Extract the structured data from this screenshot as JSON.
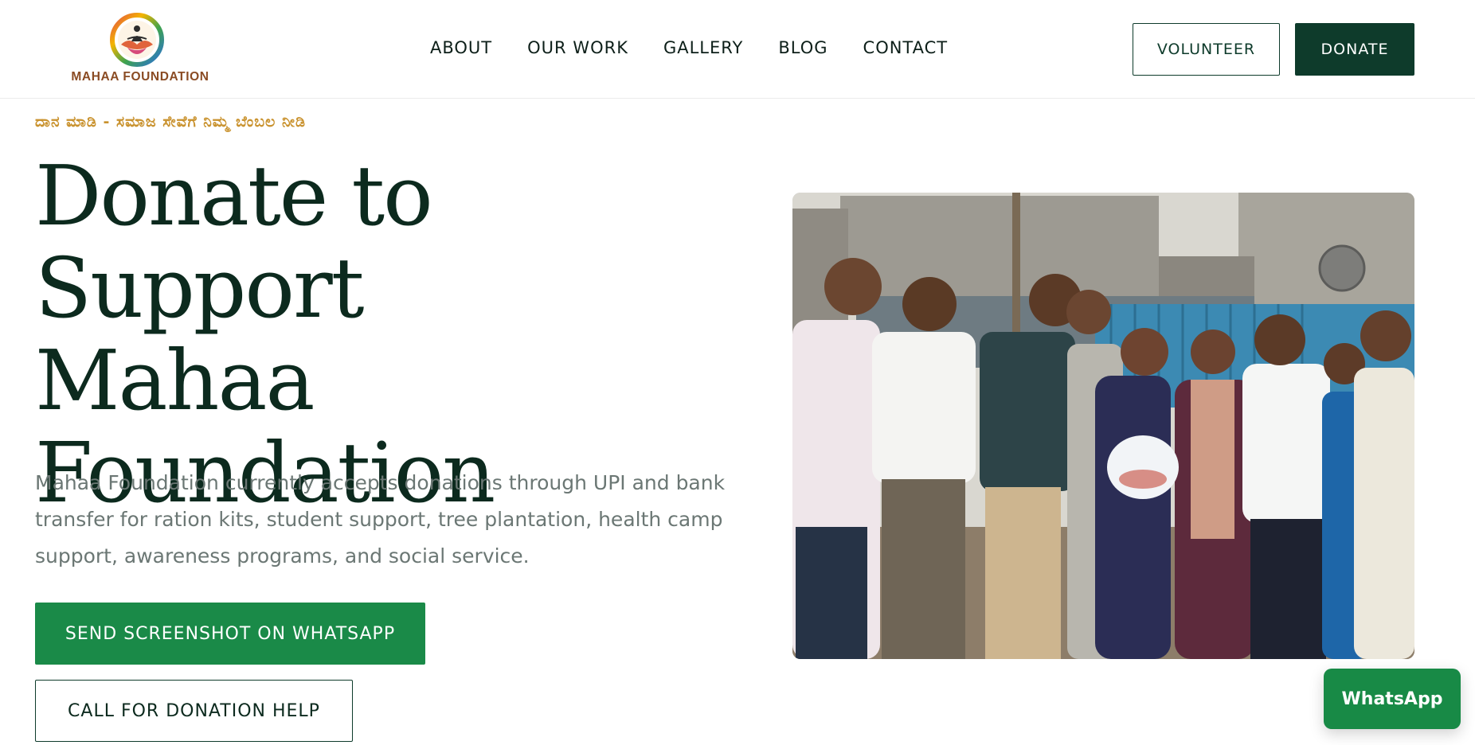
{
  "brand": {
    "name": "MAHAA FOUNDATION",
    "logo_icon": "lotus-meditation-icon",
    "colors": {
      "primary_dark": "#0e3b2b",
      "accent_green": "#1a8a48",
      "gold": "#c9922e",
      "brand_brown": "#8a4b23"
    }
  },
  "nav": {
    "items": [
      {
        "label": "ABOUT"
      },
      {
        "label": "OUR WORK"
      },
      {
        "label": "GALLERY"
      },
      {
        "label": "BLOG"
      },
      {
        "label": "CONTACT"
      }
    ]
  },
  "header_actions": {
    "volunteer_label": "VOLUNTEER",
    "donate_label": "DONATE"
  },
  "hero": {
    "kicker": "ದಾನ ಮಾಡಿ - ಸಮಾಜ ಸೇವೆಗೆ ನಿಮ್ಮ ಬೆಂಬಲ ನೀಡಿ",
    "title_lines": [
      "Donate to Support",
      "Mahaa",
      "Foundation"
    ],
    "description": "Mahaa Foundation currently accepts donations through UPI and bank transfer for ration kits, student support, tree plantation, health camp support, awareness programs, and social service.",
    "primary_cta": "SEND SCREENSHOT ON WHATSAPP",
    "secondary_cta": "CALL FOR DONATION HELP"
  },
  "floating": {
    "whatsapp_label": "WhatsApp"
  }
}
